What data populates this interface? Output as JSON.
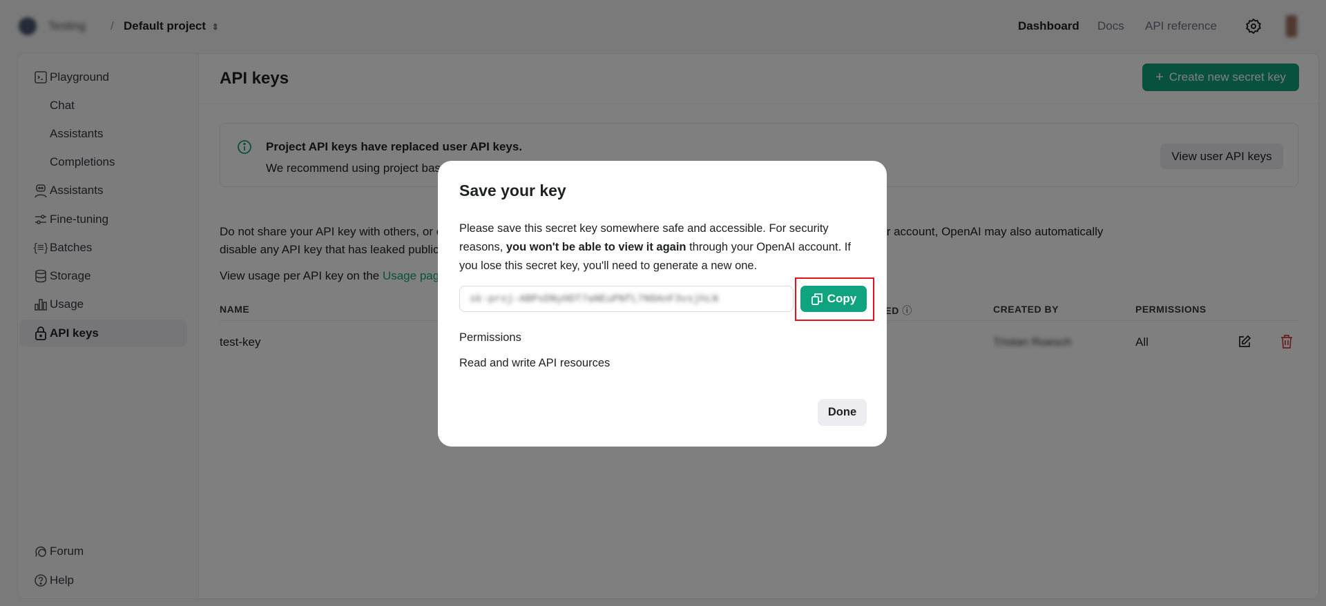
{
  "topbar": {
    "org_name": "Testing",
    "separator": "/",
    "project": "Default project",
    "nav": [
      "Dashboard",
      "Docs",
      "API reference"
    ]
  },
  "sidebar": {
    "items": [
      {
        "label": "Playground",
        "icon": "terminal-icon"
      },
      {
        "label": "Chat",
        "icon": ""
      },
      {
        "label": "Assistants",
        "icon": ""
      },
      {
        "label": "Completions",
        "icon": ""
      },
      {
        "label": "Assistants",
        "icon": "robot-icon"
      },
      {
        "label": "Fine-tuning",
        "icon": "sliders-icon"
      },
      {
        "label": "Batches",
        "icon": "braces-icon"
      },
      {
        "label": "Storage",
        "icon": "database-icon"
      },
      {
        "label": "Usage",
        "icon": "bar-chart-icon"
      },
      {
        "label": "API keys",
        "icon": "lock-icon",
        "active": true
      }
    ],
    "footer": [
      {
        "label": "Forum",
        "icon": "chat-bubbles-icon"
      },
      {
        "label": "Help",
        "icon": "help-icon"
      }
    ]
  },
  "page": {
    "title": "API keys",
    "create_button": "Create new secret key",
    "notice": {
      "title": "Project API keys have replaced user API keys.",
      "body": "We recommend using project based API keys for more granular control over your resources.",
      "button": "View user API keys"
    },
    "warning": "Do not share your API key with others, or expose it in the browser or other client-side code. In order to protect the security of your account, OpenAI may also automatically disable any API key that has leaked publicly.",
    "usage_prefix": "View usage per API key on the ",
    "usage_link": "Usage page.",
    "table": {
      "headers": [
        "NAME",
        "LAST USED",
        "CREATED BY",
        "PERMISSIONS"
      ],
      "rows": [
        {
          "name": "test-key",
          "created_by": "Tristan Roesch",
          "permissions": "All"
        }
      ]
    }
  },
  "modal": {
    "title": "Save your key",
    "p1": "Please save this secret key somewhere safe and accessible. For security reasons, ",
    "p_bold": "you won't be able to view it again",
    "p2": " through your OpenAI account. If you lose this secret key, you'll need to generate a new one.",
    "key_value": "sk-proj-ABPsDNyHDT7aNEuPNfL7N8AnF3vsjhLN",
    "copy_button": "Copy",
    "permissions_label": "Permissions",
    "permissions_value": "Read and write API resources",
    "done_button": "Done"
  },
  "colors": {
    "accent": "#10a37f",
    "highlight": "#e5101a",
    "danger": "#d93a3a"
  }
}
